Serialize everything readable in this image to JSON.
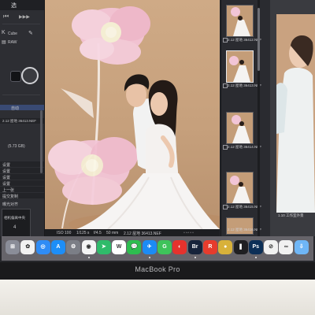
{
  "device": {
    "label": "MacBook Pro"
  },
  "left_panel": {
    "title": "选",
    "toolbar_glyphs": [
      "⏮",
      "▶▶▶"
    ],
    "tool_label": "Cube",
    "format_label": "RAW",
    "section_label": "自动",
    "file_name": "2.12 屋地 36413.NEF",
    "file_size": "(5.73 GB)",
    "options": [
      "设置",
      "设置",
      "设置",
      "设置",
      "上一张",
      "提交复制"
    ],
    "footer_label": "曝光对齐",
    "box_lines": [
      "相机偏离中央",
      "4"
    ]
  },
  "photo_status": {
    "iso": "ISO 100",
    "shutter": "1/125 s",
    "aperture": "f/4.5",
    "focal": "50 mm",
    "file_name": "2.12 屋地 36413.NEF"
  },
  "filmstrip": {
    "labels": [
      "2.12 屋地 36412.NEF",
      "2.12 屋地 36413.NEF",
      "2.12 屋地 36414.NEF",
      "2.12 屋地 36415.NEF",
      "2.12 屋地 36416.NEF"
    ],
    "selected_index": 1
  },
  "right_preview": {
    "label": "1.10 工作室外景"
  },
  "dock": {
    "apps": [
      {
        "name": "Launchpad",
        "glyph": "⊞",
        "color": "#8a8d98"
      },
      {
        "name": "Photos",
        "glyph": "✿",
        "color": "#f2f2f2"
      },
      {
        "name": "Safari",
        "glyph": "◎",
        "color": "#2f8cf5"
      },
      {
        "name": "App Store",
        "glyph": "A",
        "color": "#1d8ef7"
      },
      {
        "name": "Settings",
        "glyph": "⚙",
        "color": "#7b7e86"
      },
      {
        "name": "Chrome",
        "glyph": "◉",
        "color": "#f4f4f4"
      },
      {
        "name": "Navigation",
        "glyph": "➤",
        "color": "#2fbb6a"
      },
      {
        "name": "WPS",
        "glyph": "W",
        "color": "#ffffff"
      },
      {
        "name": "WeChat",
        "glyph": "💬",
        "color": "#2dbd4f"
      },
      {
        "name": "Messages",
        "glyph": "✈",
        "color": "#1c8bf5"
      },
      {
        "name": "Green App",
        "glyph": "G",
        "color": "#3ec35a"
      },
      {
        "name": "NetEase Music",
        "glyph": "◐",
        "color": "#e5322d"
      },
      {
        "name": "Bridge",
        "glyph": "Br",
        "color": "#16233a"
      },
      {
        "name": "Red App",
        "glyph": "R",
        "color": "#e63c2d"
      },
      {
        "name": "Notes",
        "glyph": "●",
        "color": "#d8b13a"
      },
      {
        "name": "Capture One",
        "glyph": "❚",
        "color": "#1f1f22"
      },
      {
        "name": "Photoshop",
        "glyph": "Ps",
        "color": "#0c2f57"
      },
      {
        "name": "Clip",
        "glyph": "⊘",
        "color": "#f1f1f1"
      },
      {
        "name": "Link",
        "glyph": "∞",
        "color": "#f1f1f1"
      },
      {
        "name": "Downloads",
        "glyph": "⇩",
        "color": "#6fb6f6"
      }
    ]
  }
}
